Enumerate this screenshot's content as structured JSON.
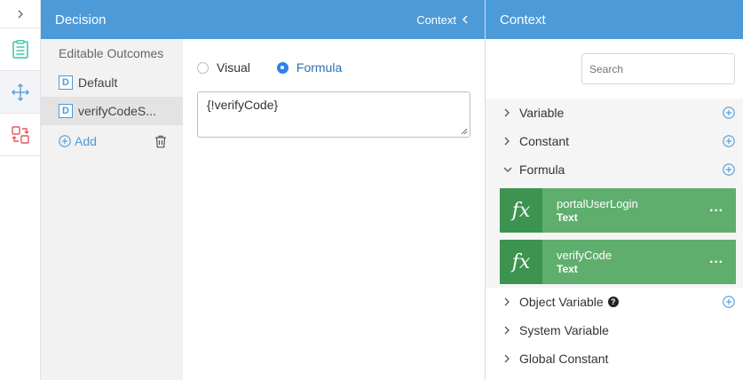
{
  "rail": {
    "expand_icon": "chevron-right-icon",
    "buttons": [
      "list-icon",
      "move-icon",
      "swap-icon"
    ]
  },
  "decision": {
    "title": "Decision",
    "context_toggle": "Context",
    "outcomes_title": "Editable Outcomes",
    "outcomes": [
      {
        "badge": "D",
        "label": "Default"
      },
      {
        "badge": "D",
        "label": "verifyCodeS..."
      }
    ],
    "add_label": "Add",
    "mode": {
      "visual_label": "Visual",
      "formula_label": "Formula",
      "selected": "Formula"
    },
    "formula_value": "{!verifyCode}"
  },
  "context": {
    "title": "Context",
    "search_placeholder": "Search",
    "categories": {
      "variable": "Variable",
      "constant": "Constant",
      "formula": "Formula",
      "object_variable": "Object Variable",
      "system_variable": "System Variable",
      "global_constant": "Global Constant"
    },
    "formulas": [
      {
        "icon": "fx",
        "name": "portalUserLogin",
        "type": "Text"
      },
      {
        "icon": "fx",
        "name": "verifyCode",
        "type": "Text"
      }
    ],
    "help_glyph": "?",
    "more_glyph": "···"
  },
  "colors": {
    "header": "#4d9ad8",
    "accent": "#2f80ed",
    "card": "#5fae6e",
    "card_icon_bg": "#3d9350"
  }
}
